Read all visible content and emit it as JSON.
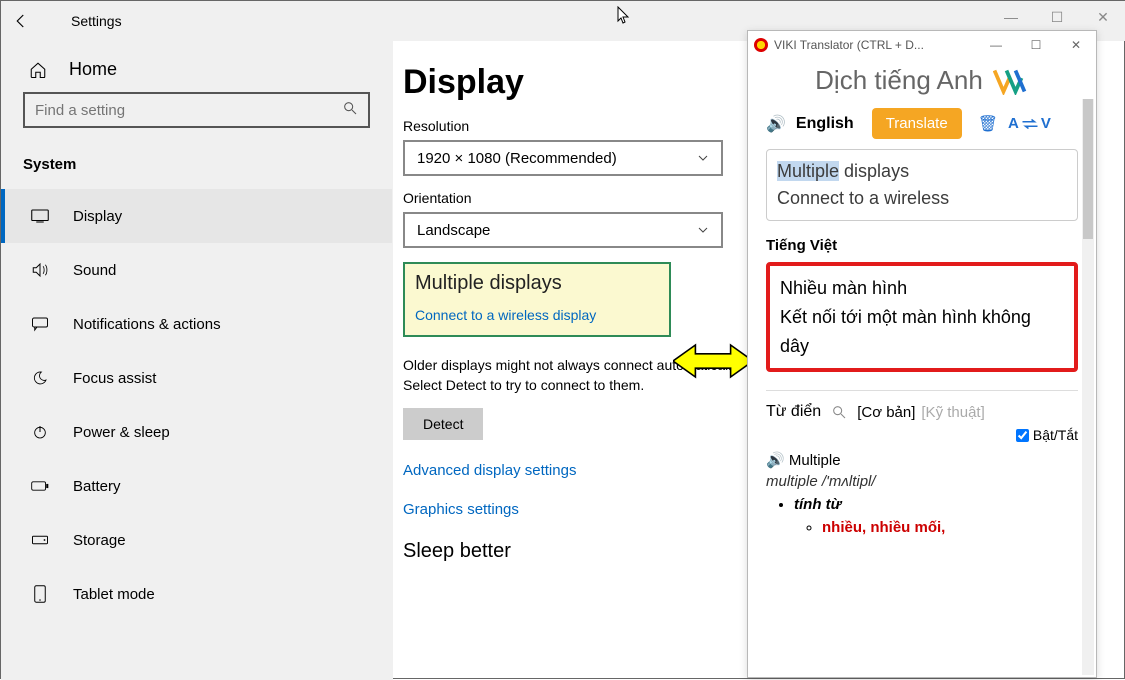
{
  "settings": {
    "title": "Settings",
    "home": "Home",
    "search_placeholder": "Find a setting",
    "section": "System",
    "nav": [
      {
        "label": "Display"
      },
      {
        "label": "Sound"
      },
      {
        "label": "Notifications & actions"
      },
      {
        "label": "Focus assist"
      },
      {
        "label": "Power & sleep"
      },
      {
        "label": "Battery"
      },
      {
        "label": "Storage"
      },
      {
        "label": "Tablet mode"
      }
    ],
    "main": {
      "page_title": "Display",
      "resolution_label": "Resolution",
      "resolution_value": "1920 × 1080 (Recommended)",
      "orientation_label": "Orientation",
      "orientation_value": "Landscape",
      "multiple_title": "Multiple displays",
      "multiple_link": "Connect to a wireless display",
      "older_desc": "Older displays might not always connect automatically. Select Detect to try to connect to them.",
      "detect": "Detect",
      "adv_link": "Advanced display settings",
      "gfx_link": "Graphics settings",
      "sleep_heading": "Sleep better"
    }
  },
  "viki": {
    "window_title": "VIKI Translator (CTRL + D...",
    "header": "Dịch tiếng Anh",
    "english_label": "English",
    "translate": "Translate",
    "av": "A ⇄ V",
    "input_selected": "Multiple",
    "input_line1_rest": " displays",
    "input_line2": "Connect to a wireless",
    "target_label": "Tiếng Việt",
    "output_line1": "Nhiều màn hình",
    "output_line2": "Kết nối tới một màn hình không dây",
    "dict_label": "Từ điển",
    "tab_basic": "[Cơ bản]",
    "tab_tech": "[Kỹ thuật]",
    "toggle_label": "Bật/Tắt",
    "dict_word": "Multiple",
    "pron": "multiple /'mʌltipl/",
    "pos": "tính từ",
    "meaning": "nhiều, nhiều mối,"
  }
}
